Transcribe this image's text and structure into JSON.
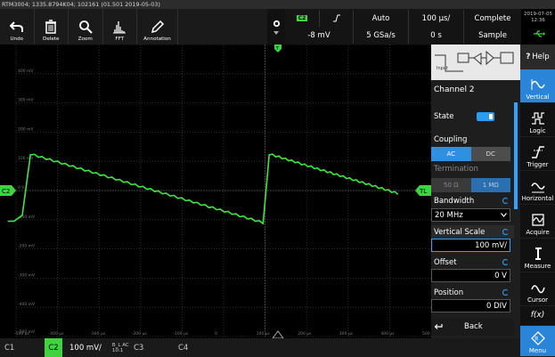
{
  "title_bar": "RTM3004; 1335.8794K04; 102161 (01.501 2019-05-03)",
  "toolbar": {
    "undo": "Undo",
    "delete": "Delete",
    "zoom": "Zoom",
    "fft": "FFT",
    "annotation": "Annotation"
  },
  "trigger": {
    "channel": "C2",
    "slope_icon": "rising-edge-icon",
    "mode": "Auto",
    "timebase": "100 µs/",
    "acq_state": "Complete",
    "level": "-8 mV",
    "sample_rate": "5 GSa/s",
    "position": "0 s",
    "acq_mode": "Sample"
  },
  "clock": {
    "date": "2019-07-05",
    "time": "12:36"
  },
  "grid": {
    "y_labels": [
      "400 mV",
      "300 mV",
      "200 mV",
      "100 mV",
      "0 V",
      "-100 mV",
      "-200 mV",
      "-300 mV",
      "-400 mV",
      "-500 mV"
    ],
    "x_labels": [
      "-500 µs",
      "-400 µs",
      "-300 µs",
      "-200 µs",
      "-100 µs",
      "0",
      "100 µs",
      "200 µs",
      "300 µs",
      "400 µs",
      "500 µs"
    ],
    "channel_marker": "C2",
    "trigger_marker": "T",
    "trigger_level_marker": "TL",
    "trace_color": "#3fe63f"
  },
  "side_panel": {
    "diagram_input_label": "Input",
    "channel": "Channel 2",
    "state_label": "State",
    "coupling_label": "Coupling",
    "coupling_ac": "AC",
    "coupling_dc": "DC",
    "termination_label": "Termination",
    "term_50": "50 Ω",
    "term_1m": "1 MΩ",
    "bandwidth_label": "Bandwidth",
    "bandwidth_value": "20 MHz",
    "vscale_label": "Vertical Scale",
    "vscale_value": "100 mV/",
    "offset_label": "Offset",
    "offset_value": "0 V",
    "position_label": "Position",
    "position_value": "0 DIV",
    "back": "Back"
  },
  "right_bar": {
    "help": "Help",
    "vertical": "Vertical",
    "logic": "Logic",
    "trigger": "Trigger",
    "horizontal": "Horizontal",
    "acquire": "Acquire",
    "measure": "Measure",
    "cursor": "Cursor",
    "fx": "f(x)",
    "menu": "Menu"
  },
  "bottom_bar": {
    "c1": "C1",
    "c2": "C2",
    "c2_scale": "100 mV/",
    "c2_coupling_top": "B_L AC",
    "c2_coupling_bottom": "10:1",
    "c3": "C3",
    "c4": "C4"
  }
}
